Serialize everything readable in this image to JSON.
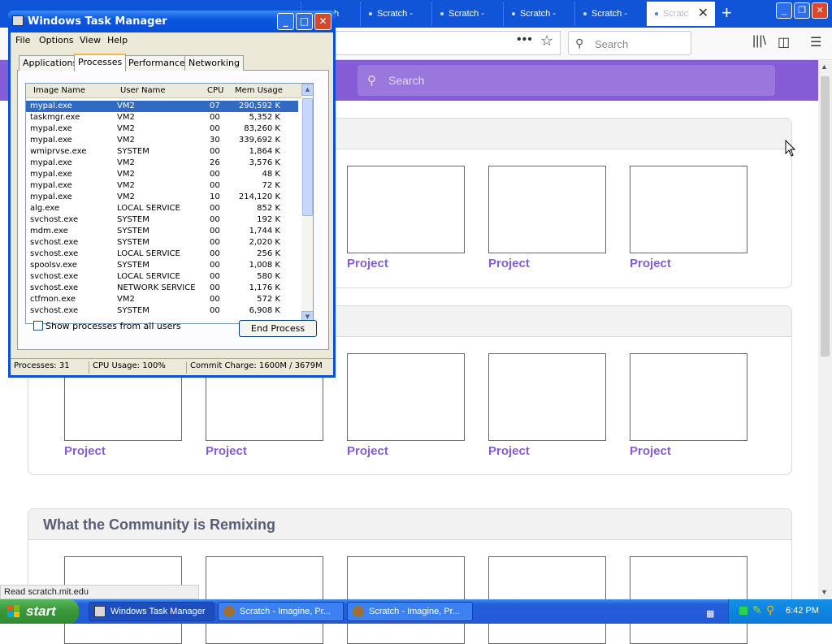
{
  "browser": {
    "tabs": [
      {
        "label": "h"
      },
      {
        "label": "Scratch -"
      },
      {
        "label": "Scratch -"
      },
      {
        "label": "Scratch -"
      },
      {
        "label": "Scratch -"
      },
      {
        "label": "Scratc"
      }
    ],
    "search_placeholder": "Search",
    "status": "Read scratch.mit.edu"
  },
  "scratch": {
    "search_placeholder": "Search",
    "project_label": "Project",
    "sections": [
      {
        "title": ""
      },
      {
        "title": ""
      },
      {
        "title": "What the Community is Remixing"
      }
    ]
  },
  "taskmanager": {
    "title": "Windows Task Manager",
    "menu": [
      "File",
      "Options",
      "View",
      "Help"
    ],
    "tabs": [
      "Applications",
      "Processes",
      "Performance",
      "Networking"
    ],
    "active_tab": "Processes",
    "columns": [
      "Image Name",
      "User Name",
      "CPU",
      "Mem Usage"
    ],
    "processes": [
      {
        "name": "mypal.exe",
        "user": "VM2",
        "cpu": "07",
        "mem": "290,592 K",
        "selected": true
      },
      {
        "name": "taskmgr.exe",
        "user": "VM2",
        "cpu": "00",
        "mem": "5,352 K"
      },
      {
        "name": "mypal.exe",
        "user": "VM2",
        "cpu": "00",
        "mem": "83,260 K"
      },
      {
        "name": "mypal.exe",
        "user": "VM2",
        "cpu": "30",
        "mem": "339,692 K"
      },
      {
        "name": "wmiprvse.exe",
        "user": "SYSTEM",
        "cpu": "00",
        "mem": "1,864 K"
      },
      {
        "name": "mypal.exe",
        "user": "VM2",
        "cpu": "26",
        "mem": "3,576 K"
      },
      {
        "name": "mypal.exe",
        "user": "VM2",
        "cpu": "00",
        "mem": "48 K"
      },
      {
        "name": "mypal.exe",
        "user": "VM2",
        "cpu": "00",
        "mem": "72 K"
      },
      {
        "name": "mypal.exe",
        "user": "VM2",
        "cpu": "10",
        "mem": "214,120 K"
      },
      {
        "name": "alg.exe",
        "user": "LOCAL SERVICE",
        "cpu": "00",
        "mem": "852 K"
      },
      {
        "name": "svchost.exe",
        "user": "SYSTEM",
        "cpu": "00",
        "mem": "192 K"
      },
      {
        "name": "mdm.exe",
        "user": "SYSTEM",
        "cpu": "00",
        "mem": "1,744 K"
      },
      {
        "name": "svchost.exe",
        "user": "SYSTEM",
        "cpu": "00",
        "mem": "2,020 K"
      },
      {
        "name": "svchost.exe",
        "user": "LOCAL SERVICE",
        "cpu": "00",
        "mem": "256 K"
      },
      {
        "name": "spoolsv.exe",
        "user": "SYSTEM",
        "cpu": "00",
        "mem": "1,008 K"
      },
      {
        "name": "svchost.exe",
        "user": "LOCAL SERVICE",
        "cpu": "00",
        "mem": "580 K"
      },
      {
        "name": "svchost.exe",
        "user": "NETWORK SERVICE",
        "cpu": "00",
        "mem": "1,176 K"
      },
      {
        "name": "ctfmon.exe",
        "user": "VM2",
        "cpu": "00",
        "mem": "572 K"
      },
      {
        "name": "svchost.exe",
        "user": "SYSTEM",
        "cpu": "00",
        "mem": "6,908 K"
      }
    ],
    "show_all_label": "Show processes from all users",
    "end_process_label": "End Process",
    "status": {
      "processes": "Processes: 31",
      "cpu": "CPU Usage: 100%",
      "commit": "Commit Charge: 1600M / 3679M"
    }
  },
  "taskbar": {
    "start_label": "start",
    "buttons": [
      "Windows Task Manager",
      "Scratch - Imagine, Pr...",
      "Scratch - Imagine, Pr..."
    ],
    "clock": "6:42 PM"
  },
  "colors": {
    "scratch_purple": "#855cd6",
    "xp_blue": "#0a4fd6",
    "selection": "#316ac5"
  }
}
